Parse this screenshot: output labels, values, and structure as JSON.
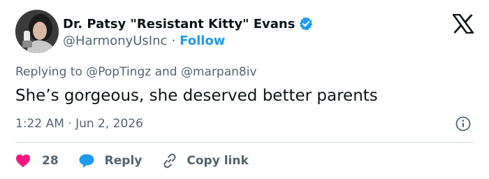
{
  "author": {
    "display_name": "Dr. Patsy \"Resistant Kitty\" Evans",
    "handle": "@HarmonyUsInc",
    "separator": "·",
    "follow_label": "Follow",
    "verified": true
  },
  "reply_context": {
    "prefix": "Replying to ",
    "mention_1": "@PopTingz",
    "joiner": " and ",
    "mention_2": "@marpan8iv"
  },
  "tweet": {
    "text": "She’s gorgeous, she deserved better parents",
    "timestamp": "1:22 AM · Jun 2, 2026"
  },
  "actions": {
    "like_count": "28",
    "reply_label": "Reply",
    "copy_link_label": "Copy link"
  },
  "icons": {
    "verified": "verified-badge-icon",
    "platform": "x-logo-icon",
    "info": "info-icon",
    "like": "heart-icon",
    "reply": "speech-bubble-icon",
    "copy_link": "link-icon"
  },
  "colors": {
    "accent": "#1d9bf0",
    "like": "#f91880",
    "text_primary": "#0f1419",
    "text_secondary": "#536471",
    "divider": "#cfd9de"
  }
}
